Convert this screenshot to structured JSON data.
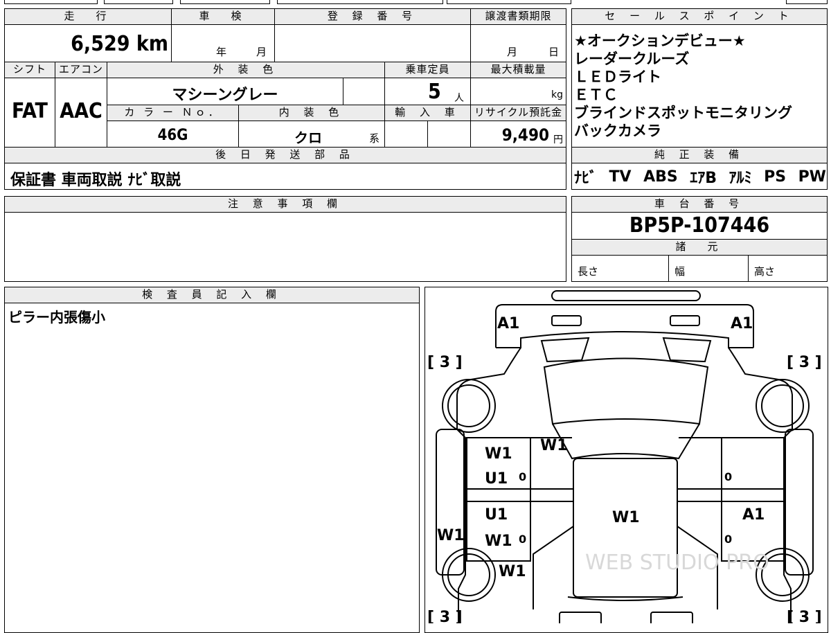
{
  "vehicle": {
    "mileage_label": "走　行",
    "mileage_value": "6,529 km",
    "inspection_label": "車　検",
    "inspection_year": "年",
    "inspection_month": "月",
    "registration_label": "登 録 番 号",
    "registration_value": "",
    "transfer_label": "譲渡書類期限",
    "transfer_month": "月",
    "transfer_day": "日",
    "shift_label": "シフト",
    "shift_value": "FAT",
    "ac_label": "エアコン",
    "ac_value": "AAC",
    "exterior_color_label": "外 装 色",
    "exterior_color_value": "マシーングレー",
    "capacity_label": "乗車定員",
    "capacity_value": "5",
    "capacity_unit": "人",
    "max_load_label": "最大積載量",
    "max_load_unit": "kg",
    "color_no_label": "カ ラ ー Ｎｏ．",
    "color_no_value": "46G",
    "interior_color_label": "内 装 色",
    "interior_color_value": "クロ",
    "interior_color_suffix": "系",
    "import_label": "輸 入 車",
    "recycle_label": "リサイクル預託金",
    "recycle_value": "9,490",
    "recycle_unit": "円"
  },
  "later_parts": {
    "label": "後 日 発 送 部 品",
    "value": "保証書 車両取説 ﾅﾋﾞ取説"
  },
  "sales_points": {
    "label": "セ ー ル ス ポ イ ン ト",
    "items": [
      "★オークションデビュー★",
      "レーダークルーズ",
      "ＬＥＤライト",
      "ＥＴＣ",
      "ブラインドスポットモニタリング",
      "バックカメラ"
    ]
  },
  "genuine_equipment": {
    "label": "純 正 装 備",
    "items": [
      "ﾅﾋﾞ",
      "TV",
      "ABS",
      "ｴｱB",
      "ｱﾙﾐ",
      "PS",
      "PW"
    ]
  },
  "notes": {
    "label": "注 意 事 項 欄",
    "value": ""
  },
  "chassis": {
    "label": "車 台 番 号",
    "value": "BP5P-107446"
  },
  "specs": {
    "label": "諸　元",
    "length_label": "長さ",
    "width_label": "幅",
    "height_label": "高さ"
  },
  "inspector": {
    "label": "検 査 員 記 入 欄",
    "value": "ピラー内張傷小"
  },
  "damage_map": {
    "marks": {
      "front_left": "A1",
      "front_right": "A1",
      "tire_fl": "[ 3 ]",
      "tire_fr": "[ 3 ]",
      "tire_rl": "[ 3 ]",
      "tire_rr": "[ 3 ]",
      "windshield_left": "W1",
      "door_fl_1": "W1",
      "door_fl_2": "U1",
      "door_fl_zero": "0",
      "door_rl_1": "U1",
      "door_rl_2": "W1",
      "door_rl_zero": "0",
      "side_left": "W1",
      "roof": "W1",
      "rear_left_low": "W1",
      "door_fr_zero": "0",
      "door_rr_mark": "A1",
      "door_rr_zero": "0"
    },
    "watermark": "WEB STUDIO PRO"
  }
}
